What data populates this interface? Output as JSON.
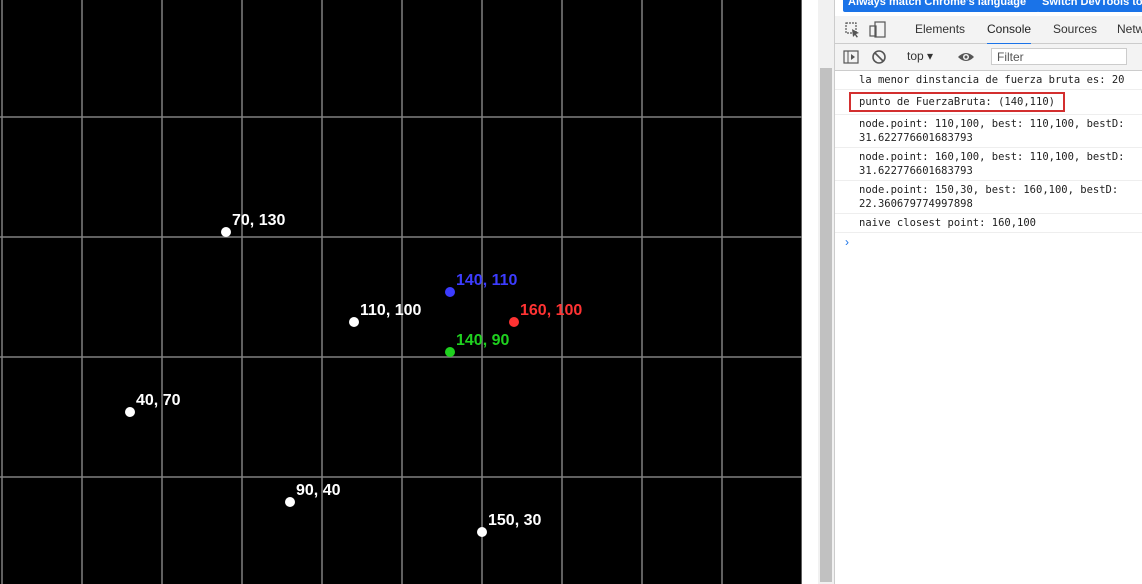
{
  "canvas": {
    "background": "#000000",
    "grid_color": "#808080",
    "points": [
      {
        "label": "70, 130",
        "color": "#ffffff"
      },
      {
        "label": "140, 110",
        "color": "#3c3cff"
      },
      {
        "label": "110, 100",
        "color": "#ffffff"
      },
      {
        "label": "160, 100",
        "color": "#ff3333"
      },
      {
        "label": "140, 90",
        "color": "#1fd11f"
      },
      {
        "label": "40, 70",
        "color": "#ffffff"
      },
      {
        "label": "90, 40",
        "color": "#ffffff"
      },
      {
        "label": "150, 30",
        "color": "#ffffff"
      }
    ]
  },
  "devtools": {
    "lang_buttons": [
      "Always match Chrome's language",
      "Switch DevTools to"
    ],
    "tabs": [
      "Elements",
      "Console",
      "Sources",
      "Netw"
    ],
    "active_tab": "Console",
    "context": "top",
    "filter_placeholder": "Filter",
    "console_lines": [
      "la menor dinstancia de fuerza bruta es: 20",
      "punto de FuerzaBruta: (140,110)",
      "node.point: 110,100, best: 110,100, bestD:\n31.622776601683793",
      "node.point: 160,100, best: 110,100, bestD:\n31.622776601683793",
      "node.point: 150,30, best: 160,100, bestD:\n22.360679774997898",
      "naive closest point: 160,100"
    ],
    "prompt": "›"
  }
}
